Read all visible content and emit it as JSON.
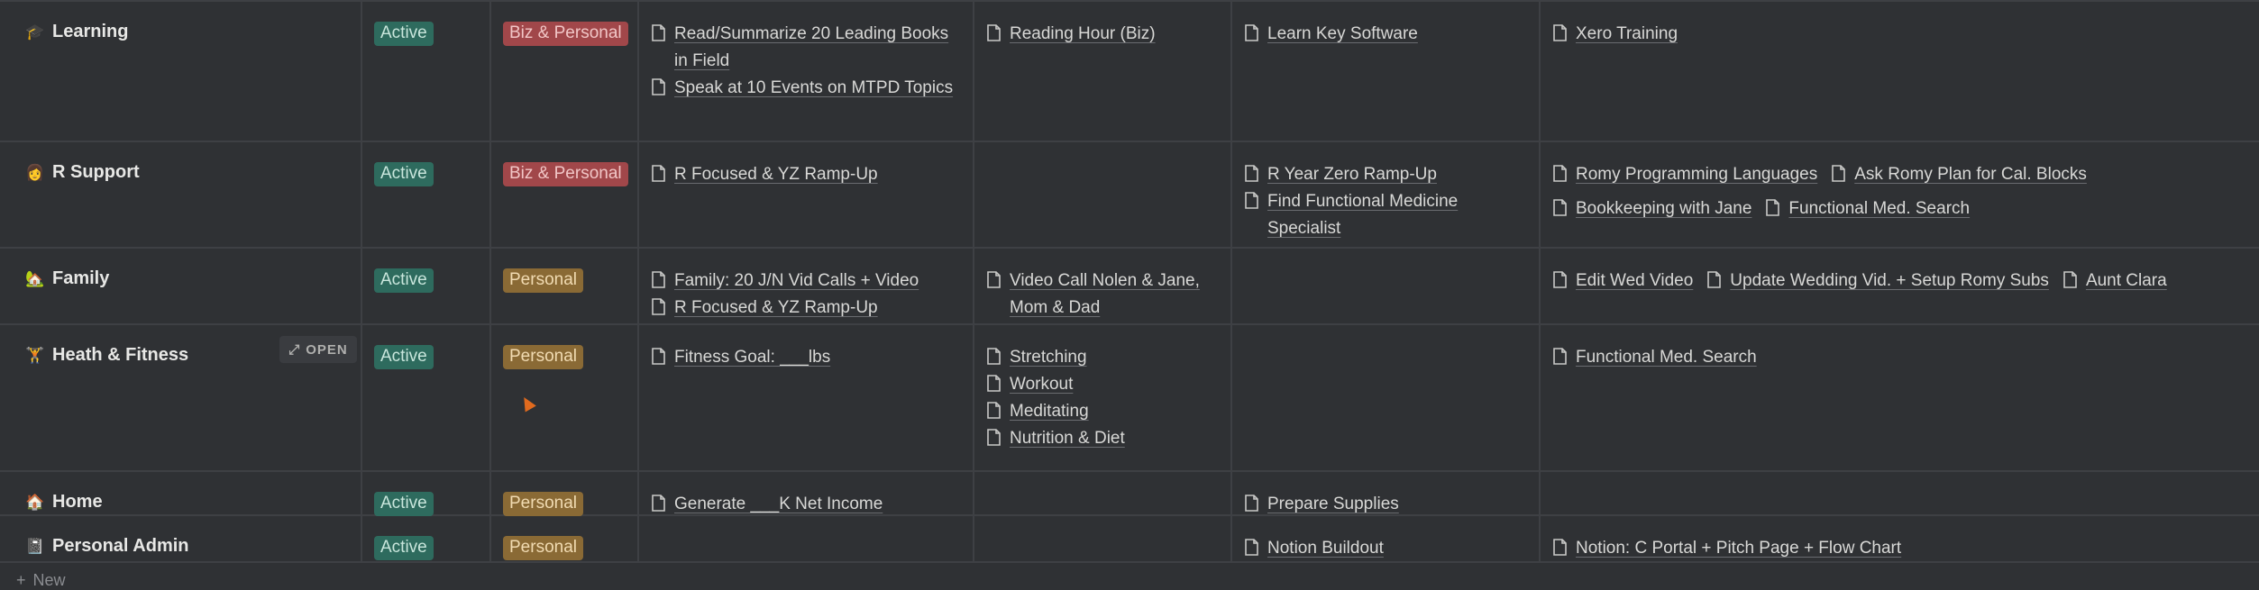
{
  "rows": [
    {
      "name": "Learning",
      "icon": "graduation-cap-icon",
      "emoji": "🎓",
      "status": "Active",
      "area": "Biz & Personal",
      "area_kind": "biz",
      "col3": [
        "Read/Summarize 20 Leading Books in Field",
        "Speak at 10 Events on MTPD Topics"
      ],
      "col4": [
        "Reading Hour (Biz)"
      ],
      "col5": [
        "Learn Key Software"
      ],
      "col6": [
        "Xero Training"
      ]
    },
    {
      "name": "R Support",
      "icon": "person-icon",
      "emoji": "👩",
      "status": "Active",
      "area": "Biz & Personal",
      "area_kind": "biz",
      "col3": [
        "R Focused & YZ Ramp-Up"
      ],
      "col4": [],
      "col5": [
        "R Year Zero Ramp-Up",
        "Find Functional Medicine Specialist"
      ],
      "col6": [
        "Romy Programming Languages",
        "Ask Romy Plan for Cal. Blocks",
        "Bookkeeping with Jane",
        "Functional Med. Search"
      ]
    },
    {
      "name": "Family",
      "icon": "house-icon",
      "emoji": "🏡",
      "status": "Active",
      "area": "Personal",
      "area_kind": "personal",
      "col3": [
        "Family: 20 J/N Vid Calls + Video",
        "R Focused & YZ Ramp-Up"
      ],
      "col4": [
        "Video Call Nolen & Jane, Mom & Dad"
      ],
      "col5": [],
      "col6": [
        "Edit Wed Video",
        "Update Wedding Vid. + Setup Romy Subs",
        "Aunt Clara"
      ]
    },
    {
      "name": "Heath & Fitness",
      "icon": "dumbbell-icon",
      "emoji": "🏋",
      "status": "Active",
      "area": "Personal",
      "area_kind": "personal",
      "col3": [
        "Fitness Goal: ___lbs"
      ],
      "col4": [
        "Stretching",
        "Workout",
        "Meditating",
        "Nutrition & Diet"
      ],
      "col5": [],
      "col6": [
        "Functional Med. Search"
      ]
    },
    {
      "name": "Home",
      "icon": "house-icon",
      "emoji": "🏠",
      "status": "Active",
      "area": "Personal",
      "area_kind": "personal",
      "col3": [
        "Generate ___K Net Income"
      ],
      "col4": [],
      "col5": [
        "Prepare Supplies"
      ],
      "col6": []
    },
    {
      "name": "Personal Admin",
      "icon": "notebook-icon",
      "emoji": "📓",
      "status": "Active",
      "area": "Personal",
      "area_kind": "personal",
      "col3": [],
      "col4": [],
      "col5": [
        "Notion Buildout"
      ],
      "col6": [
        "Notion: C Portal + Pitch Page + Flow Chart"
      ]
    }
  ],
  "open_button_label": "OPEN",
  "new_label": "New",
  "colors": {
    "background": "#2f3134",
    "active_tag": "#2e6b5e",
    "biz_tag": "#a1474a",
    "personal_tag": "#8a6a35"
  }
}
